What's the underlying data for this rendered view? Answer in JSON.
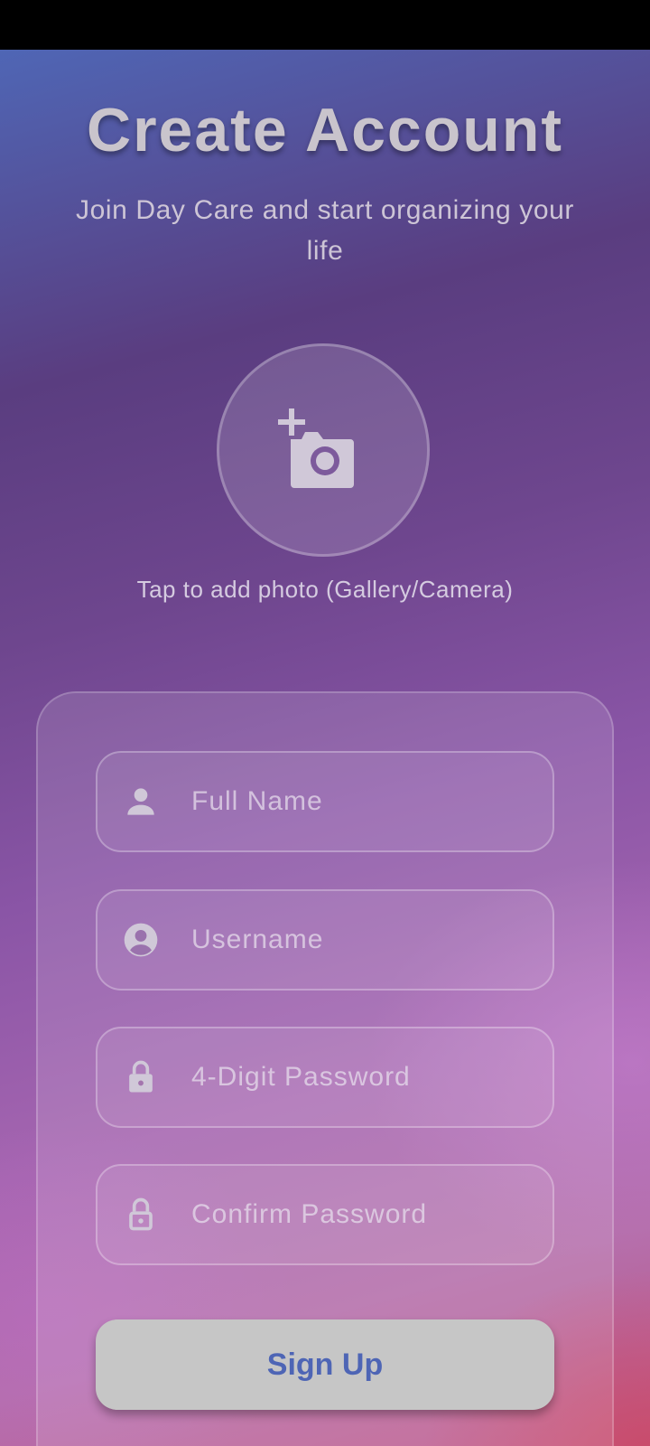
{
  "header": {
    "title": "Create Account",
    "subtitle": "Join Day Care and start organizing your life"
  },
  "photo": {
    "icon": "add-photo-camera-icon",
    "hint": "Tap to add photo (Gallery/Camera)"
  },
  "form": {
    "fields": [
      {
        "icon": "person-icon",
        "placeholder": "Full Name",
        "value": ""
      },
      {
        "icon": "account-circle-icon",
        "placeholder": "Username",
        "value": ""
      },
      {
        "icon": "lock-icon",
        "placeholder": "4-Digit Password",
        "value": ""
      },
      {
        "icon": "lock-outline-icon",
        "placeholder": "Confirm Password",
        "value": ""
      }
    ],
    "submit_label": "Sign Up"
  },
  "colors": {
    "gradient_top": "#4f66b5",
    "gradient_mid": "#8a55a6",
    "gradient_bottom": "#c05a8a",
    "button_bg": "#c6c6c6",
    "button_text": "#4e65b5",
    "icon": "#d0c8d8"
  }
}
